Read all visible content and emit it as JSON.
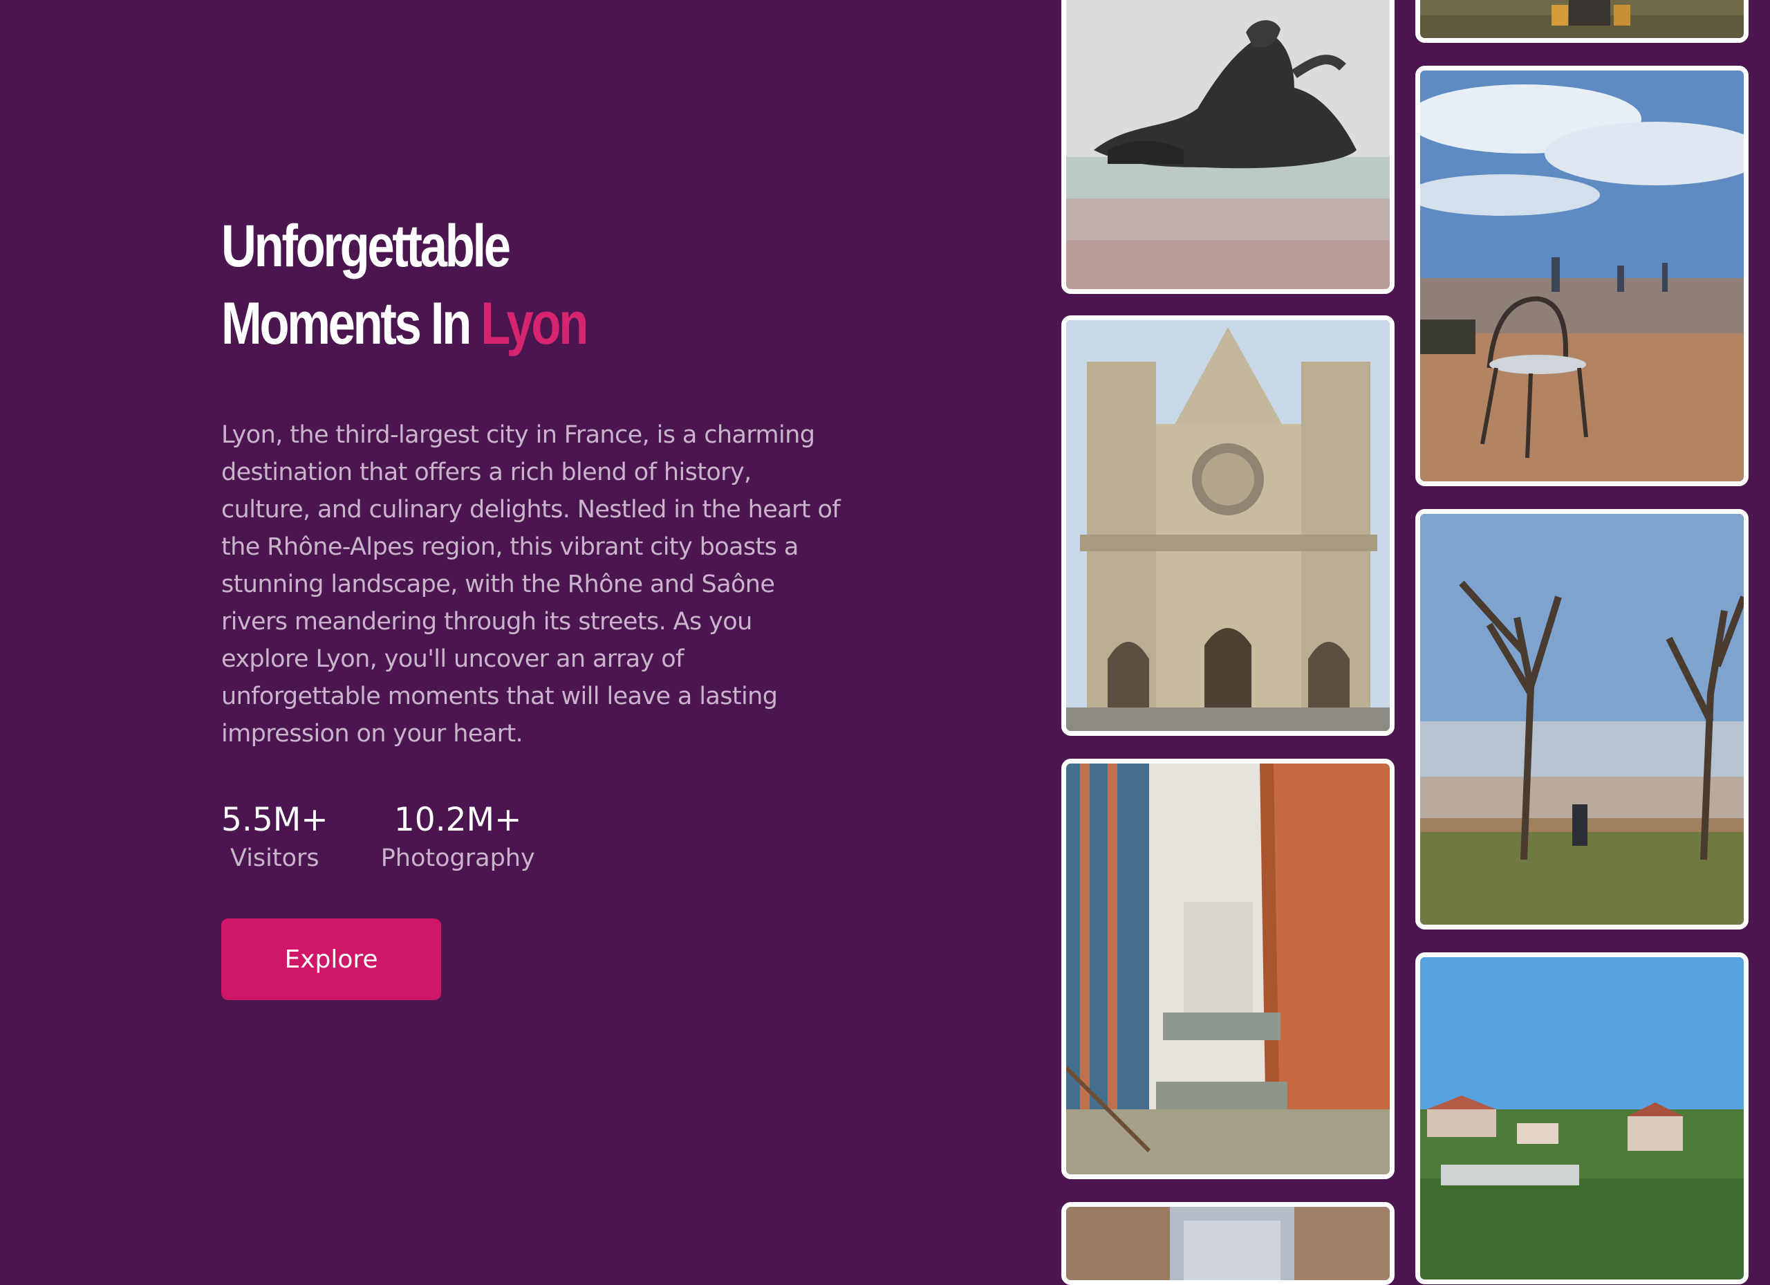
{
  "hero": {
    "title_line1": "Unforgettable",
    "title_line2_prefix": "Moments In ",
    "title_accent": "Lyon",
    "description": "Lyon, the third-largest city in France, is a charming destination that offers a rich blend of history, culture, and culinary delights. Nestled in the heart of the Rhône-Alpes region, this vibrant city boasts a stunning landscape, with the Rhône and Saône rivers meandering through its streets. As you explore Lyon, you'll uncover an array of unforgettable moments that will leave a lasting impression on your heart.",
    "stats": [
      {
        "value": "5.5M+",
        "label": "Visitors"
      },
      {
        "value": "10.2M+",
        "label": "Photography"
      }
    ],
    "explore_label": "Explore"
  },
  "gallery": {
    "photos": [
      {
        "subject": "bronze river statue"
      },
      {
        "subject": "gothic cathedral facade"
      },
      {
        "subject": "modern atrium with staircases"
      },
      {
        "subject": "street between buildings"
      },
      {
        "subject": "people sitting on grass"
      },
      {
        "subject": "chair overlooking city skyline"
      },
      {
        "subject": "bare trees on hill over city"
      },
      {
        "subject": "hillside houses with blue sky"
      }
    ]
  },
  "colors": {
    "background": "#4b1650",
    "accent": "#d01667",
    "title_accent": "#d6246e",
    "body_text": "#c9b4cb"
  }
}
